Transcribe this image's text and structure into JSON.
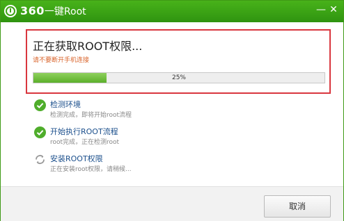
{
  "window": {
    "brand": "360",
    "title_suffix": "一键Root",
    "minimize_glyph": "—",
    "close_glyph": "✕"
  },
  "progress": {
    "title": "正在获取ROOT权限...",
    "warning": "请不要断开手机连接",
    "percent_label": "25%",
    "percent": 25
  },
  "steps": [
    {
      "title": "检测环境",
      "desc": "检测完成，即将开始root流程",
      "state": "done",
      "icon": "check-icon"
    },
    {
      "title": "开始执行ROOT流程",
      "desc": "root完成，正在检测root",
      "state": "done",
      "icon": "check-icon"
    },
    {
      "title": "安装ROOT权限",
      "desc": "正在安装root权限，请稍候...",
      "state": "in-progress",
      "icon": "refresh-icon"
    }
  ],
  "footer": {
    "cancel_label": "取消"
  },
  "colors": {
    "titlebar_green": "#3ea516",
    "check_green": "#4fad2b",
    "highlight_red": "#d9363e",
    "warning_orange": "#d9642b",
    "step_title_blue": "#1b4f8c"
  }
}
